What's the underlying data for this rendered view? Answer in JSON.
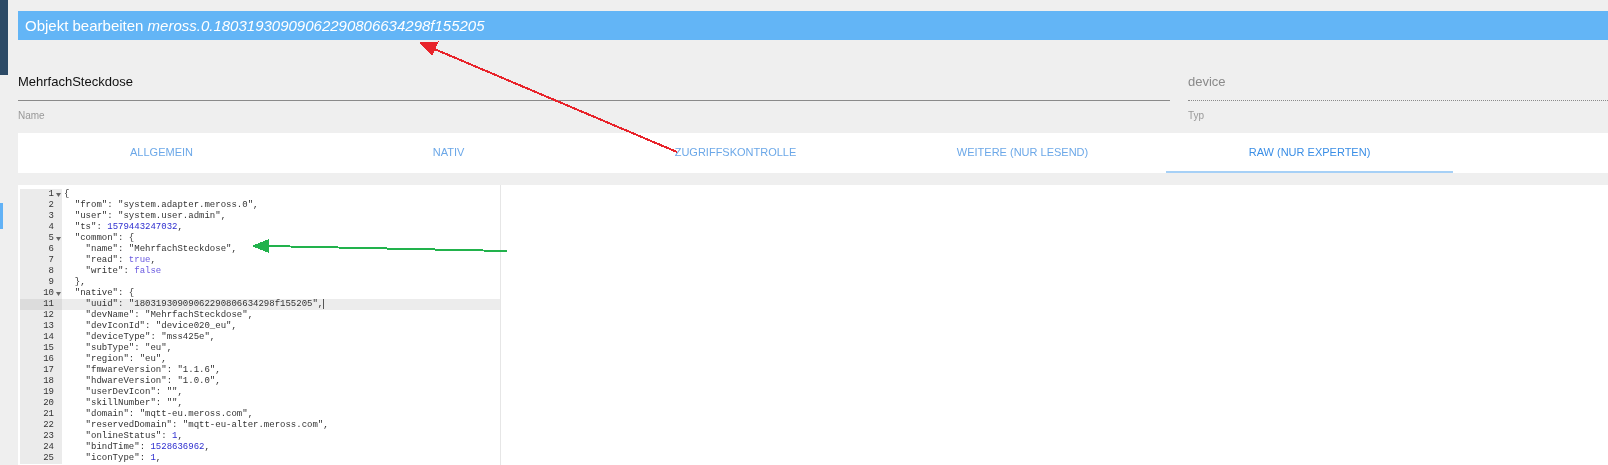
{
  "dialog": {
    "title": "Objekt bearbeiten",
    "object_id": "meross.0.18031930909062290806634298f155205"
  },
  "fields": [
    {
      "label": "Name",
      "value": "MehrfachSteckdose",
      "kind": "editable"
    },
    {
      "label": "Typ",
      "value": "device",
      "kind": "readonly"
    }
  ],
  "tabs": [
    {
      "label": "ALLGEMEIN",
      "selected": false
    },
    {
      "label": "NATIV",
      "selected": false
    },
    {
      "label": "ZUGRIFFSKONTROLLE",
      "selected": false
    },
    {
      "label": "WEITERE (NUR LESEND)",
      "selected": false
    },
    {
      "label": "RAW (NUR EXPERTEN)",
      "selected": true
    }
  ],
  "editor": {
    "lines": [
      {
        "number": "1",
        "text": "{",
        "foldable": true,
        "active": false
      },
      {
        "number": "2",
        "text": "  \"from\": \"system.adapter.meross.0\",",
        "foldable": false,
        "active": false
      },
      {
        "number": "3",
        "text": "  \"user\": \"system.user.admin\",",
        "foldable": false,
        "active": false
      },
      {
        "number": "4",
        "text": "  \"ts\": 1579443247032,",
        "foldable": false,
        "active": false
      },
      {
        "number": "5",
        "text": "  \"common\": {",
        "foldable": true,
        "active": false
      },
      {
        "number": "6",
        "text": "    \"name\": \"MehrfachSteckdose\",",
        "foldable": false,
        "active": false
      },
      {
        "number": "7",
        "text": "    \"read\": true,",
        "foldable": false,
        "active": false
      },
      {
        "number": "8",
        "text": "    \"write\": false",
        "foldable": false,
        "active": false
      },
      {
        "number": "9",
        "text": "  },",
        "foldable": false,
        "active": false
      },
      {
        "number": "10",
        "text": "  \"native\": {",
        "foldable": true,
        "active": false
      },
      {
        "number": "11",
        "text": "    \"uuid\": \"18031930909062290806634298f155205\",",
        "foldable": false,
        "active": true
      },
      {
        "number": "12",
        "text": "    \"devName\": \"MehrfachSteckdose\",",
        "foldable": false,
        "active": false
      },
      {
        "number": "13",
        "text": "    \"devIconId\": \"device020_eu\",",
        "foldable": false,
        "active": false
      },
      {
        "number": "14",
        "text": "    \"deviceType\": \"mss425e\",",
        "foldable": false,
        "active": false
      },
      {
        "number": "15",
        "text": "    \"subType\": \"eu\",",
        "foldable": false,
        "active": false
      },
      {
        "number": "16",
        "text": "    \"region\": \"eu\",",
        "foldable": false,
        "active": false
      },
      {
        "number": "17",
        "text": "    \"fmwareVersion\": \"1.1.6\",",
        "foldable": false,
        "active": false
      },
      {
        "number": "18",
        "text": "    \"hdwareVersion\": \"1.0.0\",",
        "foldable": false,
        "active": false
      },
      {
        "number": "19",
        "text": "    \"userDevIcon\": \"\",",
        "foldable": false,
        "active": false
      },
      {
        "number": "20",
        "text": "    \"skillNumber\": \"\",",
        "foldable": false,
        "active": false
      },
      {
        "number": "21",
        "text": "    \"domain\": \"mqtt-eu.meross.com\",",
        "foldable": false,
        "active": false
      },
      {
        "number": "22",
        "text": "    \"reservedDomain\": \"mqtt-eu-alter.meross.com\",",
        "foldable": false,
        "active": false
      },
      {
        "number": "23",
        "text": "    \"onlineStatus\": 1,",
        "foldable": false,
        "active": false
      },
      {
        "number": "24",
        "text": "    \"bindTime\": 1528636962,",
        "foldable": false,
        "active": false
      },
      {
        "number": "25",
        "text": "    \"iconType\": 1,",
        "foldable": false,
        "active": false
      }
    ]
  },
  "annotations": [
    {
      "color": "#e8232a"
    },
    {
      "color": "#22b24c"
    }
  ]
}
